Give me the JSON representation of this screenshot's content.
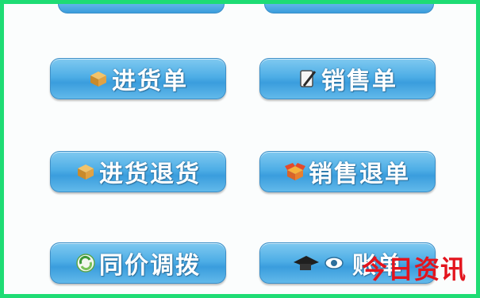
{
  "buttons": {
    "purchase_order": {
      "label": "进货单",
      "icon": "package-icon"
    },
    "sales_order": {
      "label": "销售单",
      "icon": "pen-check-icon"
    },
    "purchase_return": {
      "label": "进货退货",
      "icon": "package-icon"
    },
    "sales_return": {
      "label": "销售退单",
      "icon": "open-box-icon"
    },
    "price_adjust": {
      "label": "同价调拨",
      "icon": "recycle-icon"
    },
    "bill_query": {
      "label": "账单",
      "icon": "hat-eye-icon"
    }
  },
  "watermark": {
    "text": "今日资讯"
  },
  "colors": {
    "border": "#1edc74",
    "button": "#4eaee6",
    "watermark": "#e3141d"
  }
}
